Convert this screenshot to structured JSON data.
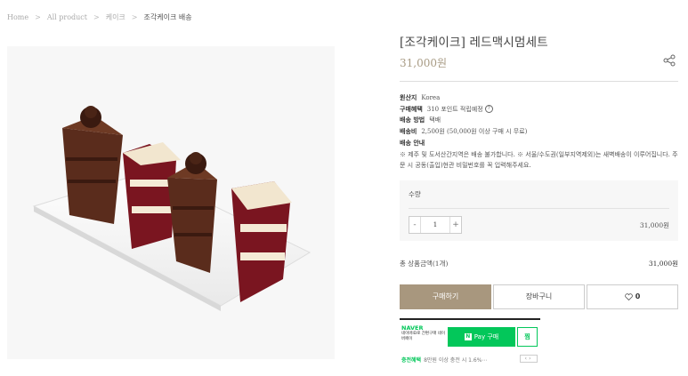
{
  "breadcrumb": [
    "Home",
    "All product",
    "케이크",
    "조각케이크 배송"
  ],
  "breadcrumb_sep": ">",
  "product": {
    "title": "[조각케이크] 레드맥시멈세트",
    "price": "31,000원"
  },
  "info": {
    "origin_label": "원산지",
    "origin_value": "Korea",
    "benefit_label": "구매혜택",
    "benefit_value": "310 포인트 적립예정",
    "shipping_method_label": "배송 방법",
    "shipping_method_value": "택배",
    "shipping_fee_label": "배송비",
    "shipping_fee_value": "2,500원 (50,000원 이상 구매 시 무료)",
    "guide_label": "배송 안내",
    "guide_text": "※ 제주 및 도서산간지역은 배송 불가합니다. ※ 서울/수도권(일부지역제외)는 새벽배송이 이루어집니다. 주문 시 공동(출입)현관 비밀번호를 꼭 입력해주세요."
  },
  "quantity": {
    "label": "수량",
    "value": "1",
    "minus": "-",
    "plus": "+",
    "line_price": "31,000원"
  },
  "total": {
    "label": "총 상품금액(1개)",
    "value": "31,000원"
  },
  "buttons": {
    "buy": "구매하기",
    "cart": "장바구니",
    "wish_count": "0"
  },
  "naver": {
    "logo": "NAVER",
    "sub": "네이버ID로 간편구매 네이버페이",
    "pay_badge": "N",
    "pay": "Pay 구매",
    "zzim": "찜",
    "promo_label": "충전혜택",
    "promo_text": "8만원 이상 충전 시 1.6%⋯"
  },
  "colors": {
    "accent": "#a8977e",
    "naver_green": "#03c75a"
  }
}
